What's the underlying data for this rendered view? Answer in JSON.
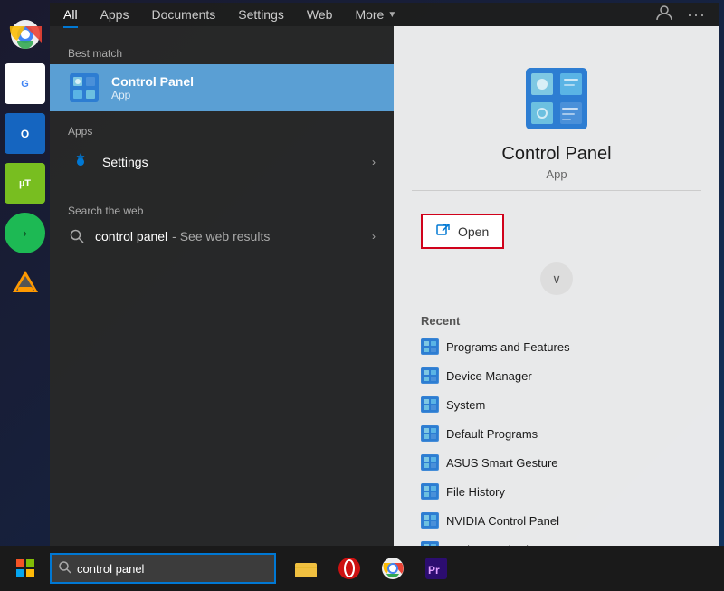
{
  "nav": {
    "tabs": [
      {
        "label": "All",
        "active": true
      },
      {
        "label": "Apps"
      },
      {
        "label": "Documents"
      },
      {
        "label": "Settings"
      },
      {
        "label": "Web"
      },
      {
        "label": "More",
        "hasArrow": true
      }
    ],
    "icons": {
      "person": "👤",
      "ellipsis": "···"
    }
  },
  "best_match": {
    "section_label": "Best match",
    "item_name": "Control Panel",
    "item_type": "App"
  },
  "apps": {
    "section_label": "Apps",
    "items": [
      {
        "name": "Settings",
        "icon": "gear"
      }
    ]
  },
  "search_web": {
    "section_label": "Search the web",
    "query": "control panel",
    "see_results_text": "- See web results",
    "arrow": "›"
  },
  "right_panel": {
    "app_name": "Control Panel",
    "app_type": "App",
    "open_label": "Open",
    "expand_icon": "∨",
    "recent_label": "Recent",
    "recent_items": [
      {
        "name": "Programs and Features"
      },
      {
        "name": "Device Manager"
      },
      {
        "name": "System"
      },
      {
        "name": "Default Programs"
      },
      {
        "name": "ASUS Smart Gesture"
      },
      {
        "name": "File History"
      },
      {
        "name": "NVIDIA Control Panel"
      },
      {
        "name": "Devices and Printers"
      }
    ]
  },
  "search_bar": {
    "value": "control panel",
    "placeholder": "control panel"
  },
  "taskbar": {
    "start_icon": "⊞",
    "apps": [
      {
        "name": "File Explorer",
        "color": "#f0c040"
      },
      {
        "name": "Opera",
        "color": "#cc1111"
      },
      {
        "name": "Chrome",
        "color": "#4285f4"
      },
      {
        "name": "Premiere Pro",
        "color": "#2c0d70"
      }
    ]
  }
}
